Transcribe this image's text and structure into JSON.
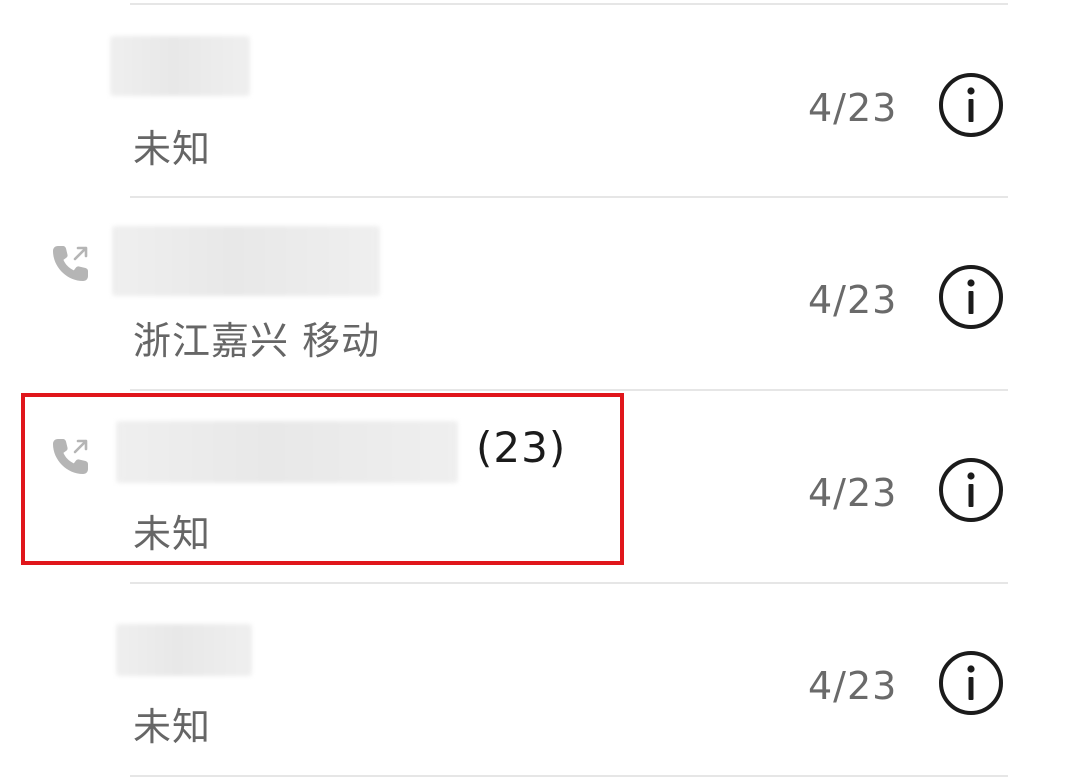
{
  "call_log": {
    "rows": [
      {
        "location": "未知",
        "date": "4/23",
        "count": "",
        "has_call_icon": false
      },
      {
        "location": "浙江嘉兴 移动",
        "date": "4/23",
        "count": "",
        "has_call_icon": true
      },
      {
        "location": "未知",
        "date": "4/23",
        "count": "(23)",
        "has_call_icon": true
      },
      {
        "location": "未知",
        "date": "4/23",
        "count": "",
        "has_call_icon": false
      }
    ]
  },
  "icons": {
    "call": "outgoing-call-icon",
    "info": "info-icon"
  },
  "colors": {
    "highlight": "#e0161b",
    "divider": "#e6e6e6",
    "secondary_text": "#666666"
  }
}
